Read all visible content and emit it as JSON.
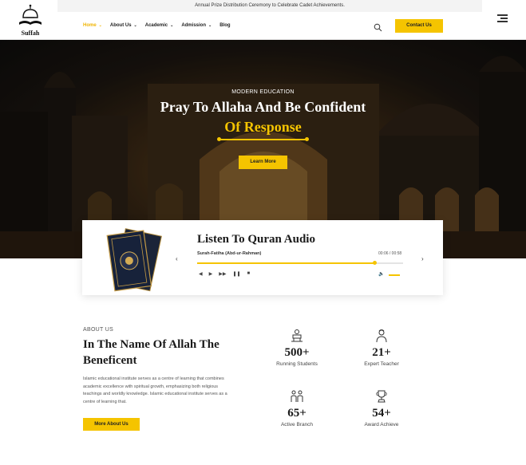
{
  "header": {
    "logo_text": "Suffah",
    "announcement": "Annual Prize Distribution Ceremony to Celebrate Cadet Achievements.",
    "nav": [
      {
        "label": "Home",
        "has_dropdown": true,
        "active": true
      },
      {
        "label": "About Us",
        "has_dropdown": true,
        "active": false
      },
      {
        "label": "Academic",
        "has_dropdown": true,
        "active": false
      },
      {
        "label": "Admission",
        "has_dropdown": true,
        "active": false
      },
      {
        "label": "Blog",
        "has_dropdown": false,
        "active": false
      }
    ],
    "contact_label": "Contact Us"
  },
  "hero": {
    "kicker": "MODERN EDUCATION",
    "title_line1": "Pray To Allaha And Be Confident",
    "title_line2": "Of Response",
    "button_label": "Learn More"
  },
  "audio": {
    "title": "Listen To Quran Audio",
    "track": "Surah-Fatiha (Abd-ur-Rahman)",
    "time": "00:06 / 00:58",
    "progress": 0.86,
    "volume": 1.0
  },
  "about": {
    "kicker": "ABOUT US",
    "title": "In The Name Of Allah The Beneficent",
    "body": "Islamic educational institute serves as a centre of learning that combines academic excellence with spiritual growth, emphasizing both religious teachings and worldly knowledge. Islamic educational institute serves as a centre of learning that.",
    "button_label": "More About Us"
  },
  "stats": [
    {
      "value": "500+",
      "label": "Running Students",
      "icon": "students-icon"
    },
    {
      "value": "21+",
      "label": "Expert Teacher",
      "icon": "teacher-icon"
    },
    {
      "value": "65+",
      "label": "Active Branch",
      "icon": "branch-icon"
    },
    {
      "value": "54+",
      "label": "Award Achieve",
      "icon": "award-icon"
    }
  ],
  "colors": {
    "accent": "#f5c400",
    "text": "#1a1a1a"
  }
}
